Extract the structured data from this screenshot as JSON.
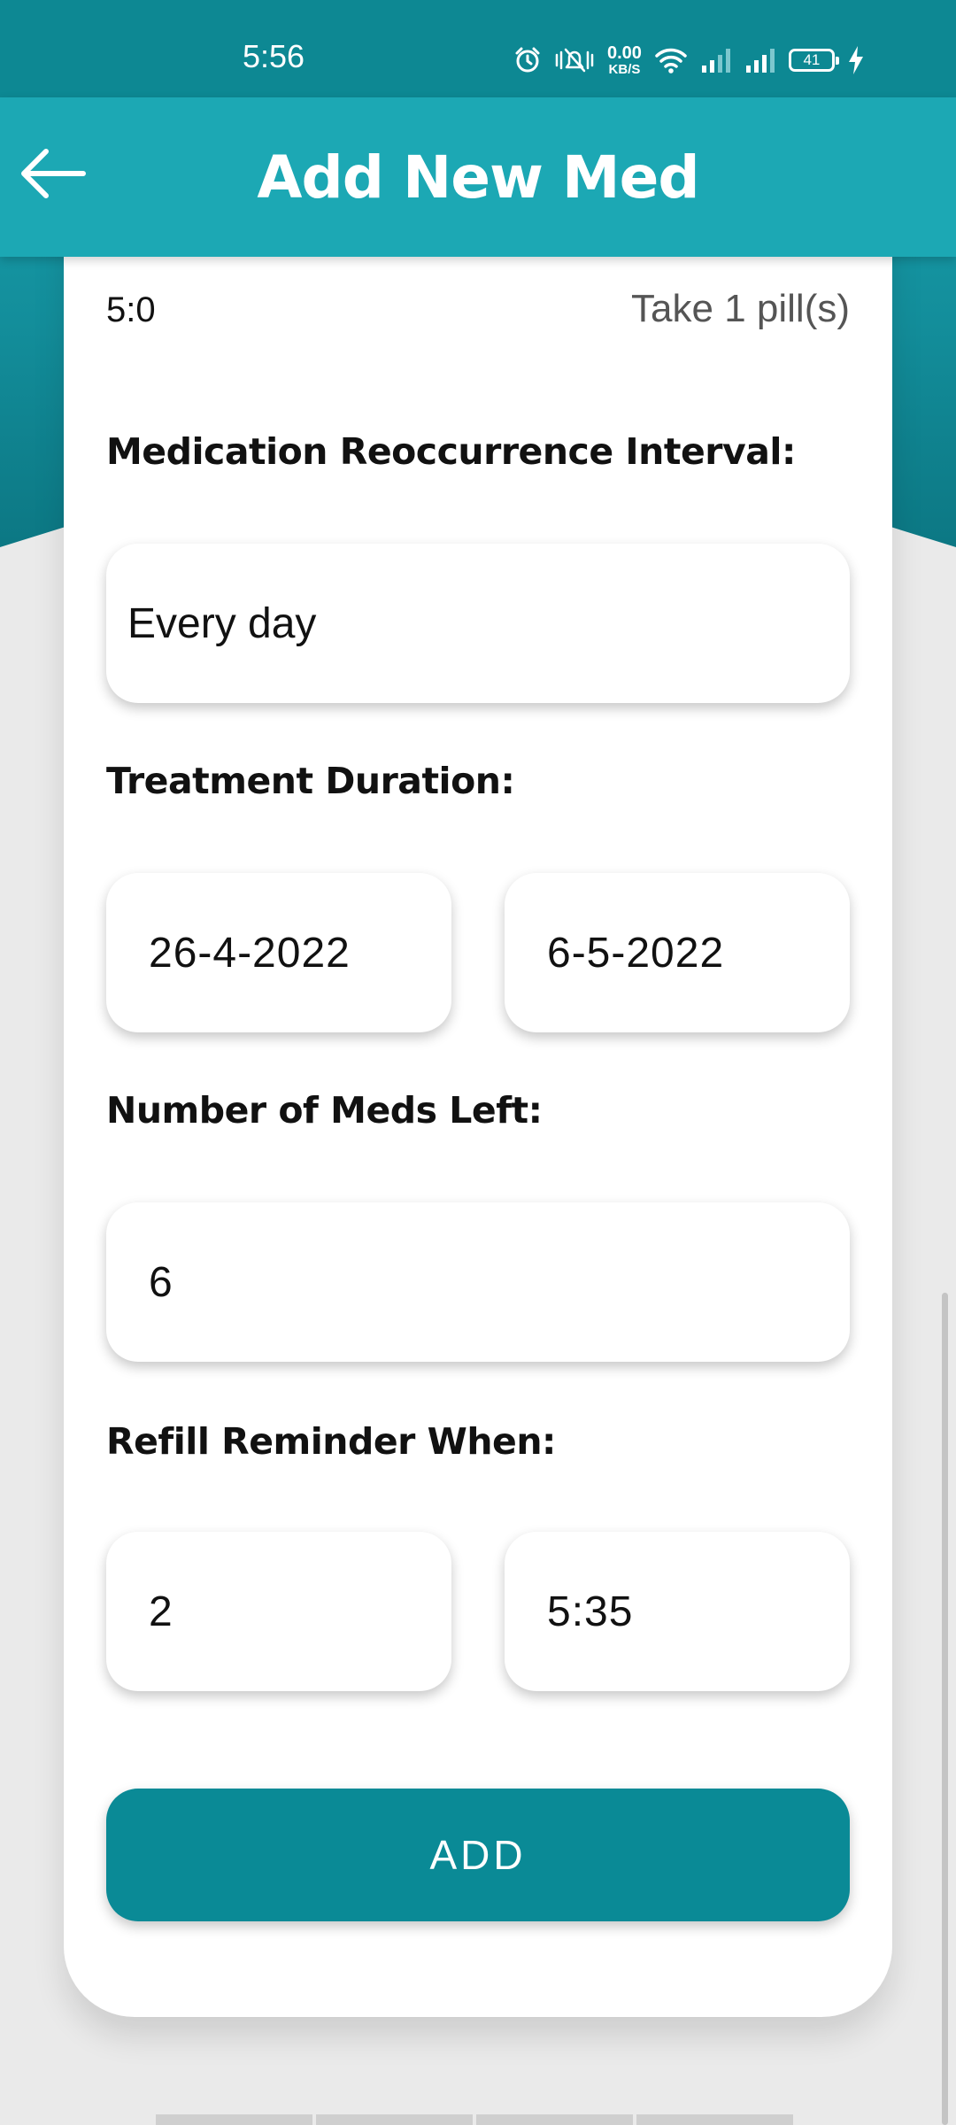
{
  "status_bar": {
    "time": "5:56",
    "net_speed_value": "0.00",
    "net_speed_unit": "KB/S",
    "battery": "41",
    "icons": [
      "alarm-icon",
      "vibrate-mute-icon",
      "wifi-icon",
      "signal-icon",
      "signal-icon",
      "battery-icon",
      "charging-icon"
    ]
  },
  "header": {
    "back_icon": "arrow-left-icon",
    "title": "Add New Med"
  },
  "form": {
    "dose_time": "5:0",
    "dose_amount": "Take 1 pill(s)",
    "reoccurrence_label": "Medication Reoccurrence Interval:",
    "reoccurrence_value": "Every day",
    "duration_label": "Treatment Duration:",
    "duration_start": "26-4-2022",
    "duration_end": "6-5-2022",
    "meds_left_label": "Number of Meds Left:",
    "meds_left_value": "6",
    "refill_label": "Refill Reminder When:",
    "refill_count": "2",
    "refill_time": "5:35",
    "add_button": "ADD"
  },
  "colors": {
    "primary": "#1ca8b4",
    "primary_dark": "#0a8a96",
    "background": "#eaeaea"
  }
}
